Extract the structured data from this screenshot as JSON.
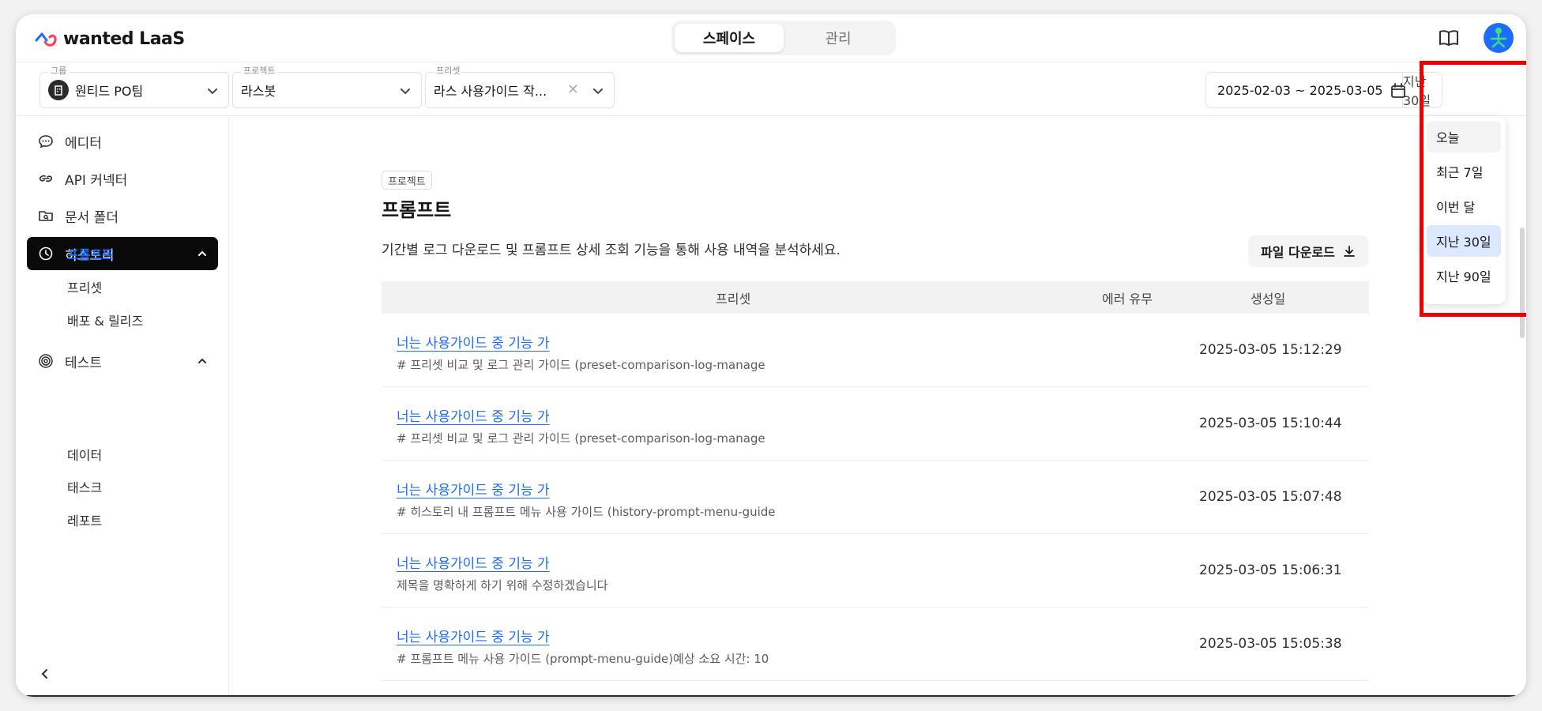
{
  "header": {
    "logo_text": "wanted LaaS",
    "tabs": [
      {
        "label": "스페이스",
        "active": true
      },
      {
        "label": "관리",
        "active": false
      }
    ]
  },
  "filters": {
    "group": {
      "label": "그룹",
      "value": "원티드 PO팀"
    },
    "project": {
      "label": "프로젝트",
      "value": "라스봇"
    },
    "preset": {
      "label": "프리셋",
      "value": "라스 사용가이드 작..."
    },
    "date_range": "2025-02-03 ~ 2025-03-05",
    "period": "지난 30일"
  },
  "period_dropdown": {
    "options": [
      {
        "label": "오늘",
        "state": "hover"
      },
      {
        "label": "최근 7일",
        "state": ""
      },
      {
        "label": "이번 달",
        "state": ""
      },
      {
        "label": "지난 30일",
        "state": "selected"
      },
      {
        "label": "지난 90일",
        "state": ""
      }
    ]
  },
  "sidebar": {
    "items": [
      {
        "label": "에디터"
      },
      {
        "label": "API 커넥터"
      },
      {
        "label": "문서 폴더"
      },
      {
        "label": "히스토리"
      },
      {
        "label": "테스트"
      }
    ],
    "history_sub": [
      "프롬프트",
      "프리셋",
      "배포 & 릴리즈"
    ],
    "test_sub": [
      "데이터",
      "태스크",
      "레포트"
    ]
  },
  "main": {
    "tag": "프로젝트",
    "title": "프롬프트",
    "description": "기간별 로그 다운로드 및 프롬프트 상세 조회 기능을 통해 사용 내역을 분석하세요.",
    "download_label": "파일 다운로드",
    "columns": [
      "프리셋",
      "에러 유무",
      "생성일"
    ],
    "rows": [
      {
        "title": "너는 사용가이드 중 기능 가",
        "sub": "# 프리셋 비교 및 로그 관리 가이드 (preset-comparison-log-manage",
        "date": "2025-03-05 15:12:29"
      },
      {
        "title": "너는 사용가이드 중 기능 가",
        "sub": "# 프리셋 비교 및 로그 관리 가이드 (preset-comparison-log-manage",
        "date": "2025-03-05 15:10:44"
      },
      {
        "title": "너는 사용가이드 중 기능 가",
        "sub": "# 히스토리 내 프롬프트 메뉴 사용 가이드 (history-prompt-menu-guide",
        "date": "2025-03-05 15:07:48"
      },
      {
        "title": "너는 사용가이드 중 기능 가",
        "sub": "제목을 명확하게 하기 위해 수정하겠습니다",
        "date": "2025-03-05 15:06:31"
      },
      {
        "title": "너는 사용가이드 중 기능 가",
        "sub": "# 프롬프트 메뉴 사용 가이드 (prompt-menu-guide)예상 소요 시간: 10",
        "date": "2025-03-05 15:05:38"
      }
    ]
  },
  "colors": {
    "accent": "#1e6cff",
    "highlight": "#ee0000",
    "active_nav": "#0a0a0b"
  }
}
